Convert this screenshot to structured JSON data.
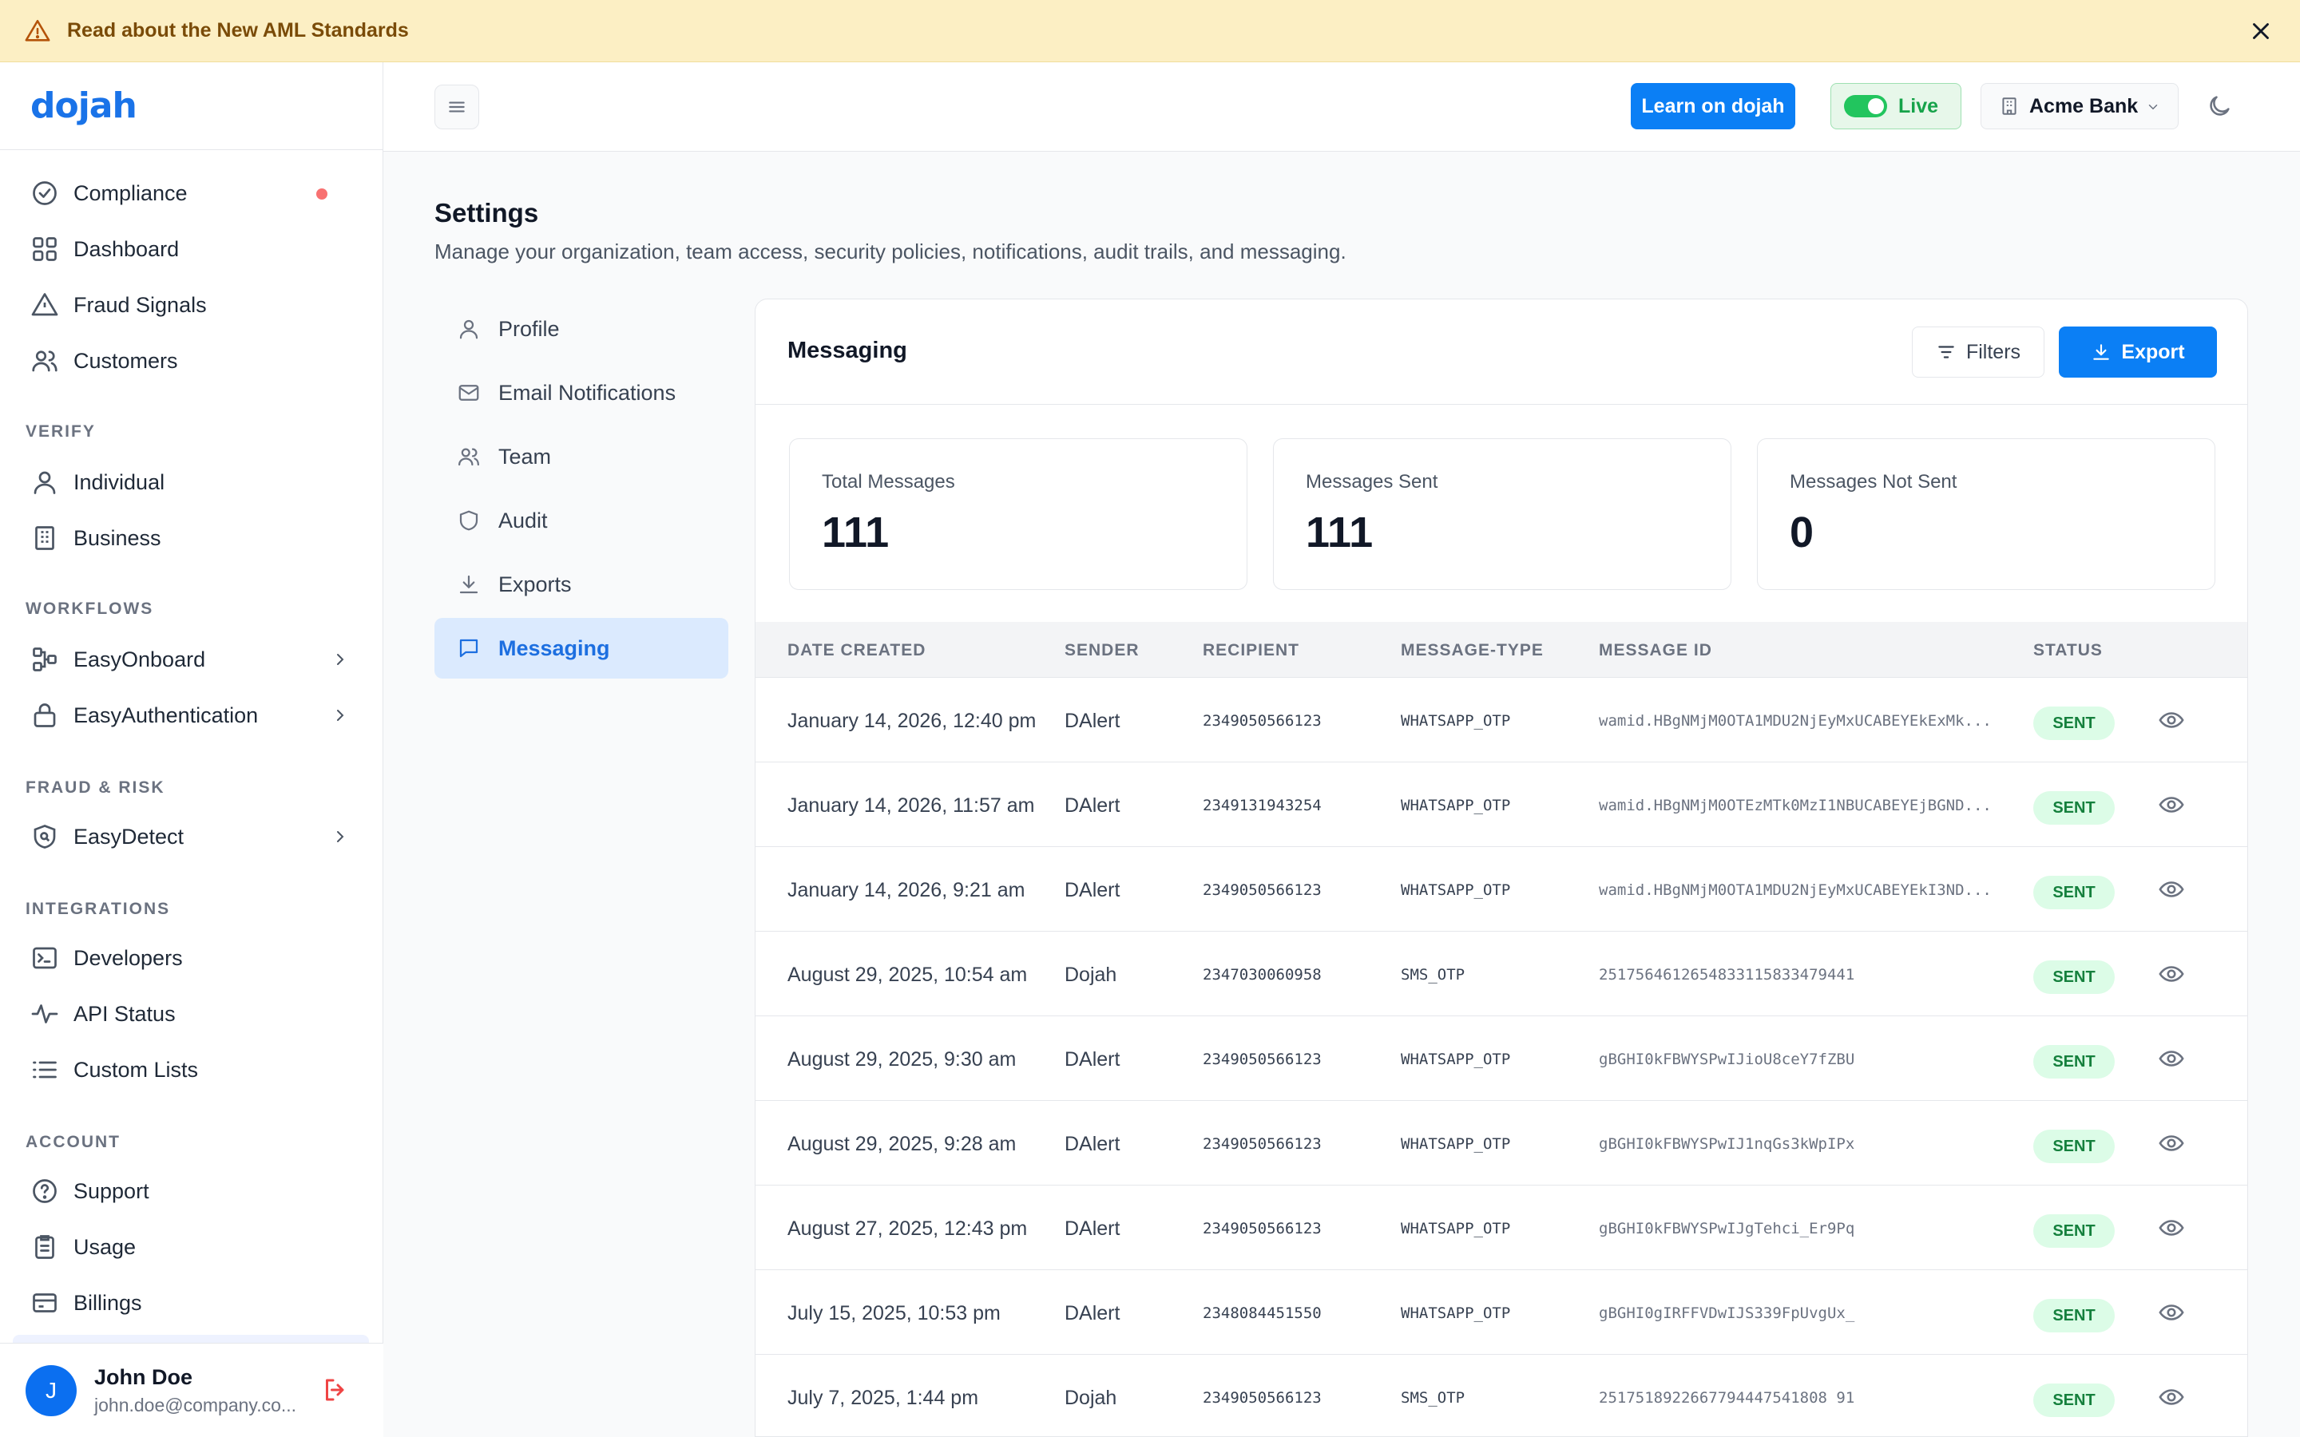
{
  "banner": {
    "text": "Read about the New AML Standards"
  },
  "brand": {
    "logo": "dojah",
    "accent": "#0b7ff5"
  },
  "sidebar": {
    "items_top": [
      {
        "label": "Compliance",
        "icon": "check-circle-icon",
        "dot": true
      },
      {
        "label": "Dashboard",
        "icon": "grid-icon"
      },
      {
        "label": "Fraud Signals",
        "icon": "alert-triangle-icon"
      },
      {
        "label": "Customers",
        "icon": "users-icon"
      }
    ],
    "sections": [
      {
        "label": "VERIFY",
        "items": [
          {
            "label": "Individual",
            "icon": "user-icon"
          },
          {
            "label": "Business",
            "icon": "building-icon"
          }
        ]
      },
      {
        "label": "WORKFLOWS",
        "items": [
          {
            "label": "EasyOnboard",
            "icon": "workflow-icon"
          },
          {
            "label": "EasyAuthentication",
            "icon": "lock-icon"
          }
        ]
      },
      {
        "label": "FRAUD & RISK",
        "items": [
          {
            "label": "EasyDetect",
            "icon": "shield-search-icon"
          }
        ]
      },
      {
        "label": "INTEGRATIONS",
        "items": [
          {
            "label": "Developers",
            "icon": "terminal-icon"
          },
          {
            "label": "API Status",
            "icon": "activity-icon"
          },
          {
            "label": "Custom Lists",
            "icon": "list-icon"
          }
        ]
      },
      {
        "label": "ACCOUNT",
        "items": [
          {
            "label": "Support",
            "icon": "help-circle-icon"
          },
          {
            "label": "Usage",
            "icon": "clipboard-icon"
          },
          {
            "label": "Billings",
            "icon": "credit-card-icon"
          }
        ]
      }
    ],
    "user": {
      "initial": "J",
      "name": "John Doe",
      "email": "john.doe@company.co..."
    }
  },
  "topbar": {
    "learn_label": "Learn on dojah",
    "live_label": "Live",
    "org_label": "Acme Bank"
  },
  "page": {
    "title": "Settings",
    "subtitle": "Manage your organization, team access, security policies, notifications, audit trails, and messaging."
  },
  "settings_nav": [
    {
      "label": "Profile",
      "icon": "user-icon"
    },
    {
      "label": "Email Notifications",
      "icon": "mail-icon"
    },
    {
      "label": "Team",
      "icon": "users-icon"
    },
    {
      "label": "Audit",
      "icon": "shield-icon"
    },
    {
      "label": "Exports",
      "icon": "download-icon"
    },
    {
      "label": "Messaging",
      "icon": "message-icon",
      "active": true
    }
  ],
  "messaging": {
    "title": "Messaging",
    "filters_label": "Filters",
    "export_label": "Export",
    "stats": [
      {
        "label": "Total Messages",
        "value": "111"
      },
      {
        "label": "Messages Sent",
        "value": "111"
      },
      {
        "label": "Messages Not Sent",
        "value": "0"
      }
    ],
    "columns": [
      "DATE CREATED",
      "SENDER",
      "RECIPIENT",
      "MESSAGE-TYPE",
      "MESSAGE ID",
      "STATUS"
    ],
    "rows": [
      {
        "date": "January 14, 2026, 12:40 pm",
        "sender": "DAlert",
        "recipient": "2349050566123",
        "type": "WHATSAPP_OTP",
        "id": "wamid.HBgNMjM0OTA1MDU2NjEyMxUCABEYEkExMk...",
        "status": "SENT"
      },
      {
        "date": "January 14, 2026, 11:57 am",
        "sender": "DAlert",
        "recipient": "2349131943254",
        "type": "WHATSAPP_OTP",
        "id": "wamid.HBgNMjM0OTEzMTk0MzI1NBUCABEYEjBGND...",
        "status": "SENT"
      },
      {
        "date": "January 14, 2026, 9:21 am",
        "sender": "DAlert",
        "recipient": "2349050566123",
        "type": "WHATSAPP_OTP",
        "id": "wamid.HBgNMjM0OTA1MDU2NjEyMxUCABEYEkI3ND...",
        "status": "SENT"
      },
      {
        "date": "August 29, 2025, 10:54 am",
        "sender": "Dojah",
        "recipient": "2347030060958",
        "type": "SMS_OTP",
        "id": "2517564612654833115833479441",
        "status": "SENT"
      },
      {
        "date": "August 29, 2025, 9:30 am",
        "sender": "DAlert",
        "recipient": "2349050566123",
        "type": "WHATSAPP_OTP",
        "id": "gBGHI0kFBWYSPwIJioU8ceY7fZBU",
        "status": "SENT"
      },
      {
        "date": "August 29, 2025, 9:28 am",
        "sender": "DAlert",
        "recipient": "2349050566123",
        "type": "WHATSAPP_OTP",
        "id": "gBGHI0kFBWYSPwIJ1nqGs3kWpIPx",
        "status": "SENT"
      },
      {
        "date": "August 27, 2025, 12:43 pm",
        "sender": "DAlert",
        "recipient": "2349050566123",
        "type": "WHATSAPP_OTP",
        "id": "gBGHI0kFBWYSPwIJgTehci_Er9Pq",
        "status": "SENT"
      },
      {
        "date": "July 15, 2025, 10:53 pm",
        "sender": "DAlert",
        "recipient": "2348084451550",
        "type": "WHATSAPP_OTP",
        "id": "gBGHI0gIRFFVDwIJS339FpUvgUx_",
        "status": "SENT"
      },
      {
        "date": "July 7, 2025, 1:44 pm",
        "sender": "Dojah",
        "recipient": "2349050566123",
        "type": "SMS_OTP",
        "id": "2517518922667794447541808 91",
        "status": "SENT"
      }
    ]
  }
}
